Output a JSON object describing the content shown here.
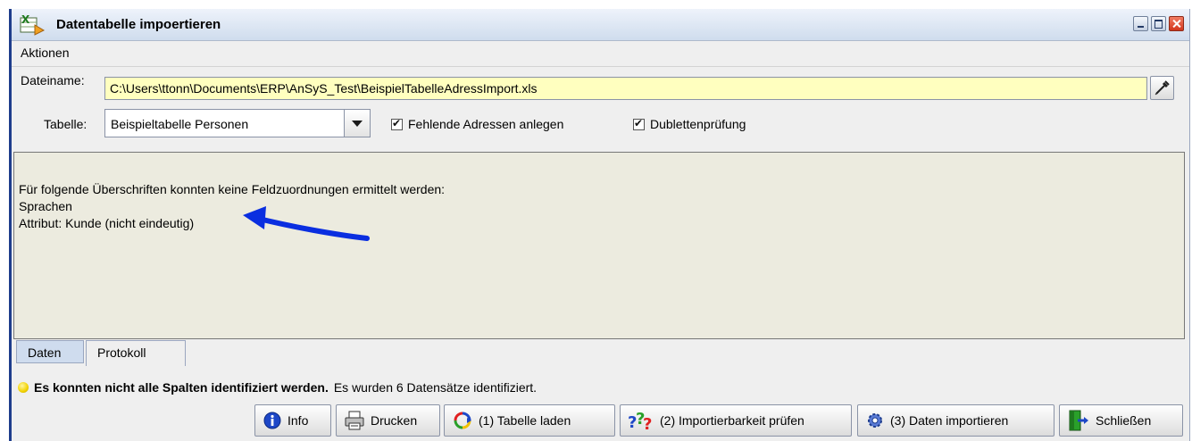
{
  "window": {
    "title": "Datentabelle impoertieren",
    "icon": "excel-import-icon"
  },
  "menu": {
    "items": [
      "Aktionen"
    ]
  },
  "form": {
    "file_label": "Dateiname:",
    "file_value": "C:\\Users\\ttonn\\Documents\\ERP\\AnSyS_Test\\BeispielTabelleAdressImport.xls",
    "table_label": "Tabelle:",
    "table_value": "Beispieltabelle Personen",
    "check_missing": {
      "label": "Fehlende Adressen anlegen",
      "checked": true
    },
    "check_duplicates": {
      "label": "Dublettenprüfung",
      "checked": true
    }
  },
  "log": {
    "lines": [
      "Für folgende Überschriften konnten keine Feldzuordnungen ermittelt werden:",
      "Sprachen",
      "Attribut: Kunde (nicht eindeutig)"
    ]
  },
  "tabs": [
    {
      "label": "Daten",
      "active": false
    },
    {
      "label": "Protokoll",
      "active": true
    }
  ],
  "status": {
    "bold": "Es konnten nicht alle Spalten identifiziert werden.",
    "normal": "Es wurden 6 Datensätze identifiziert."
  },
  "buttons": {
    "info": "Info",
    "print": "Drucken",
    "load": "(1) Tabelle laden",
    "check": "(2) Importierbarkeit prüfen",
    "import": "(3) Daten importieren",
    "close": "Schließen"
  },
  "colors": {
    "input_bg": "#ffffbf",
    "log_bg": "#ecebdf",
    "arrow": "#0a2ee0",
    "status_dot": "#f2d200"
  }
}
